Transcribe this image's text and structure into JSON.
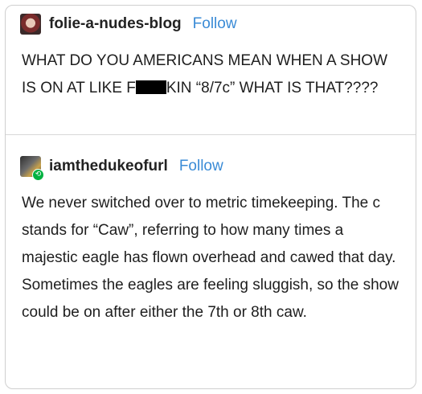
{
  "post1": {
    "username": "folie-a-nudes-blog",
    "follow_label": "Follow",
    "text_before": "WHAT DO YOU AMERICANS MEAN WHEN A SHOW IS ON AT LIKE F",
    "text_after": "KIN “8/7c” WHAT IS THAT????"
  },
  "post2": {
    "username": "iamthedukeofurl",
    "follow_label": "Follow",
    "reblog_icon_glyph": "⟲",
    "text": "We never switched over to metric timekeeping. The c stands for “Caw”, referring to how many times a majestic eagle has flown overhead and cawed that day. Sometimes the eagles are feeling sluggish, so the show could be on after either the 7th or 8th caw."
  },
  "icons": {
    "avatar1": "avatar-image",
    "avatar2": "avatar-image",
    "reblog": "reblog-icon"
  },
  "colors": {
    "follow": "#3a8bd6",
    "reblog_badge": "#00b140",
    "border": "#cfcfcf"
  }
}
